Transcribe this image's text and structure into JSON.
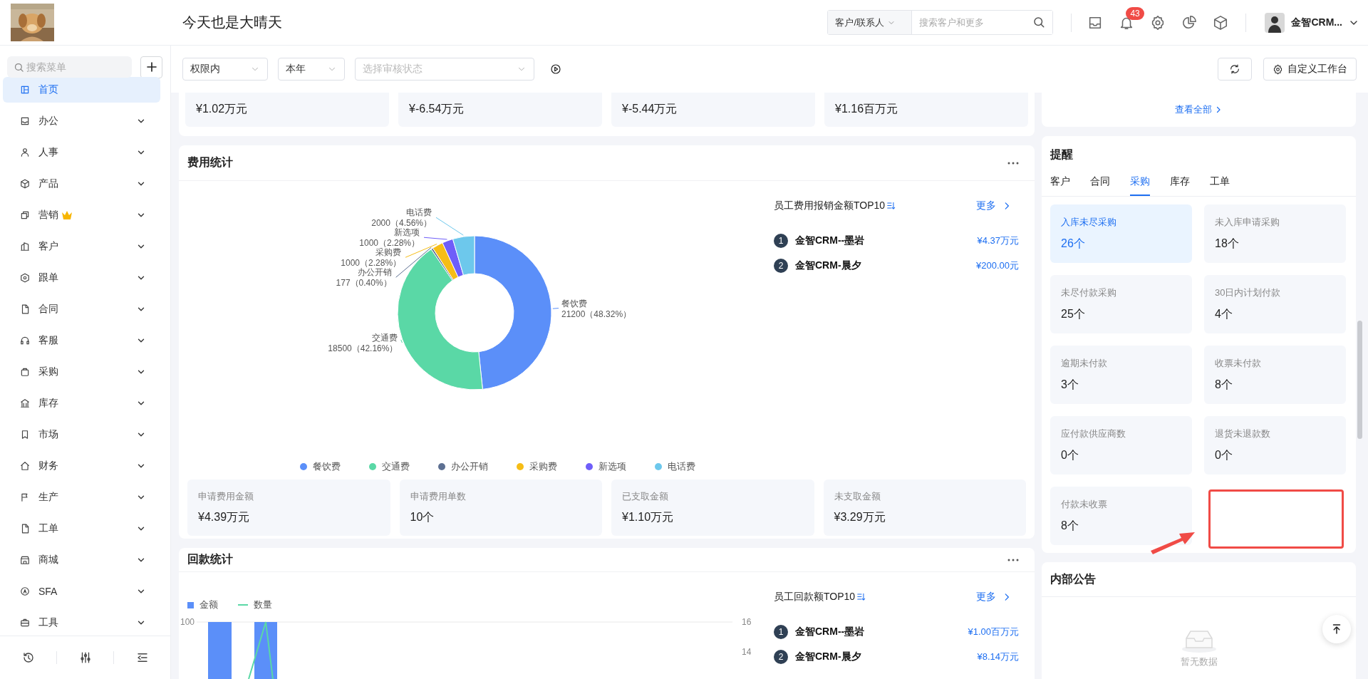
{
  "header": {
    "title": "今天也是大晴天",
    "search_scope": "客户/联系人",
    "search_placeholder": "搜索客户和更多",
    "notification_count": "43",
    "user_name": "金智CRM..."
  },
  "sidebar": {
    "search_placeholder": "搜索菜单",
    "items": [
      {
        "label": "首页",
        "selected": true,
        "expandable": false,
        "crown": false
      },
      {
        "label": "办公",
        "selected": false,
        "expandable": true,
        "crown": false
      },
      {
        "label": "人事",
        "selected": false,
        "expandable": true,
        "crown": false
      },
      {
        "label": "产品",
        "selected": false,
        "expandable": true,
        "crown": false
      },
      {
        "label": "营销",
        "selected": false,
        "expandable": true,
        "crown": true
      },
      {
        "label": "客户",
        "selected": false,
        "expandable": true,
        "crown": false
      },
      {
        "label": "跟单",
        "selected": false,
        "expandable": true,
        "crown": false
      },
      {
        "label": "合同",
        "selected": false,
        "expandable": true,
        "crown": false
      },
      {
        "label": "客服",
        "selected": false,
        "expandable": true,
        "crown": false
      },
      {
        "label": "采购",
        "selected": false,
        "expandable": true,
        "crown": false
      },
      {
        "label": "库存",
        "selected": false,
        "expandable": true,
        "crown": false
      },
      {
        "label": "市场",
        "selected": false,
        "expandable": true,
        "crown": false
      },
      {
        "label": "财务",
        "selected": false,
        "expandable": true,
        "crown": false
      },
      {
        "label": "生产",
        "selected": false,
        "expandable": true,
        "crown": false
      },
      {
        "label": "工单",
        "selected": false,
        "expandable": true,
        "crown": false
      },
      {
        "label": "商城",
        "selected": false,
        "expandable": true,
        "crown": false
      },
      {
        "label": "SFA",
        "selected": false,
        "expandable": true,
        "crown": false
      },
      {
        "label": "工具",
        "selected": false,
        "expandable": true,
        "crown": false
      }
    ]
  },
  "filters": [
    {
      "kind": "value",
      "text": "权限内"
    },
    {
      "kind": "value",
      "text": "本年"
    },
    {
      "kind": "placeholder",
      "text": "选择审核状态"
    }
  ],
  "customize_label": "自定义工作台",
  "summary_values": [
    "¥1.02万元",
    "¥-6.54万元",
    "¥-5.44万元",
    "¥1.16百万元"
  ],
  "expense": {
    "title": "费用统计",
    "chart_data": {
      "type": "donut",
      "categories": [
        "餐饮费",
        "交通费",
        "办公开销",
        "采购费",
        "新选项",
        "电话费"
      ],
      "values": [
        21200,
        18500,
        177,
        1000,
        1000,
        2000
      ],
      "legend": "bottom",
      "colors": [
        "#5b8ff9",
        "#5ad8a6",
        "#5d7092",
        "#f6bd16",
        "#6f5ef9",
        "#6dc8ec"
      ],
      "value_labels": [
        "21200（48.32%）",
        "18500（42.16%）",
        "177（0.40%）",
        "1000（2.28%）",
        "1000（2.28%）",
        "2000（4.56%）"
      ]
    },
    "top_title": "员工费用报销金额TOP10",
    "more": "更多",
    "ranking": [
      {
        "rank": "1",
        "name": "金智CRM--墨岩",
        "amount": "¥4.37万元"
      },
      {
        "rank": "2",
        "name": "金智CRM-晨夕",
        "amount": "¥200.00元"
      }
    ],
    "stats": [
      {
        "label": "申请费用金额",
        "value": "¥4.39万元"
      },
      {
        "label": "申请费用单数",
        "value": "10个"
      },
      {
        "label": "已支取金额",
        "value": "¥1.10万元"
      },
      {
        "label": "未支取金额",
        "value": "¥3.29万元"
      }
    ]
  },
  "payment": {
    "title": "回款统计",
    "legend": [
      {
        "name": "金额",
        "kind": "bar",
        "color": "#5b8ff9"
      },
      {
        "name": "数量",
        "kind": "line",
        "color": "#5ad8a6"
      }
    ],
    "left_ticks": [
      "100"
    ],
    "right_ticks": [
      "16",
      "14"
    ],
    "top_title": "员工回款额TOP10",
    "more": "更多",
    "ranking": [
      {
        "rank": "1",
        "name": "金智CRM--墨岩",
        "amount": "¥1.00百万元"
      },
      {
        "rank": "2",
        "name": "金智CRM-晨夕",
        "amount": "¥8.14万元"
      }
    ]
  },
  "view_all": "查看全部",
  "reminders": {
    "title": "提醒",
    "tabs": [
      {
        "label": "客户",
        "selected": false
      },
      {
        "label": "合同",
        "selected": false
      },
      {
        "label": "采购",
        "selected": true
      },
      {
        "label": "库存",
        "selected": false
      },
      {
        "label": "工单",
        "selected": false
      }
    ],
    "cards": [
      {
        "label": "入库未尽采购",
        "value": "26个",
        "selected": true
      },
      {
        "label": "未入库申请采购",
        "value": "18个",
        "selected": false
      },
      {
        "label": "未尽付款采购",
        "value": "25个",
        "selected": false
      },
      {
        "label": "30日内计划付款",
        "value": "4个",
        "selected": false
      },
      {
        "label": "逾期未付款",
        "value": "3个",
        "selected": false
      },
      {
        "label": "收票未付款",
        "value": "8个",
        "selected": false
      },
      {
        "label": "应付款供应商数",
        "value": "0个",
        "selected": false
      },
      {
        "label": "退货未退款数",
        "value": "0个",
        "selected": false
      },
      {
        "label": "付款未收票",
        "value": "8个",
        "selected": false
      }
    ]
  },
  "notice": {
    "title": "内部公告",
    "empty_text": "暂无数据"
  },
  "annotations": [
    {
      "kind": "box",
      "color": "#f04b46"
    },
    {
      "kind": "arrow",
      "color": "#f04b46"
    }
  ]
}
